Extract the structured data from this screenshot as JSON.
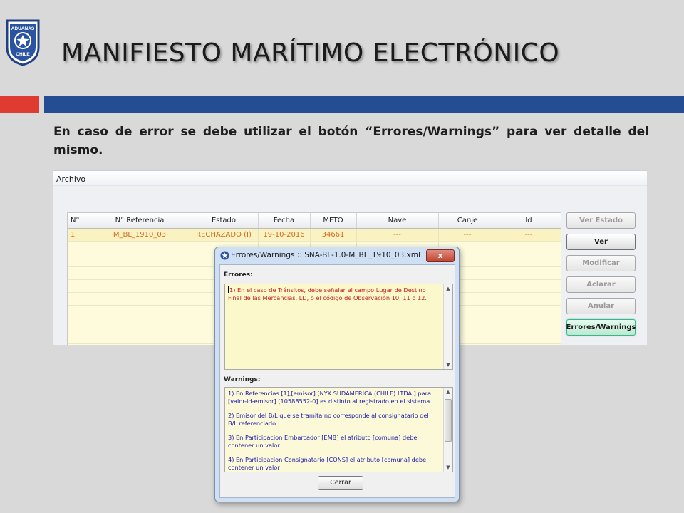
{
  "slide": {
    "title": "MANIFIESTO MARÍTIMO ELECTRÓNICO",
    "caption": "En caso de error se debe utilizar el botón “Errores/Warnings” para ver detalle del mismo.",
    "logo_text_top": "ADUANAS",
    "logo_text_bottom": "CHILE"
  },
  "app": {
    "menu": [
      "Archivo"
    ],
    "columns": [
      "N°",
      "N° Referencia",
      "Estado",
      "Fecha",
      "MFTO",
      "Nave",
      "Canje",
      "Id"
    ],
    "rows": [
      [
        "1",
        "M_BL_1910_03",
        "RECHAZADO (I)",
        "19-10-2016",
        "34661",
        "---",
        "---",
        "---"
      ]
    ],
    "buttons": {
      "ver_estado": "Ver Estado",
      "ver": "Ver",
      "modificar": "Modificar",
      "aclarar": "Aclarar",
      "anular": "Anular",
      "errores_warnings": "Errores/Warnings"
    }
  },
  "dialog": {
    "title": "Errores/Warnings :: SNA-BL-1.0-M_BL_1910_03.xml",
    "close_label": "x",
    "errores_label": "Errores:",
    "errores": [
      "1) En el caso de Tránsitos, debe señalar el campo Lugar de Destino Final de las Mercancias, LD,  o el código de Observación 10, 11 o 12."
    ],
    "warnings_label": "Warnings:",
    "warnings": [
      "1) En Referencias [1],[emisor] [NYK SUDAMERICA (CHILE) LTDA.] para [valor-id-emisor] [10588552-0] es distinto al registrado en el sistema",
      "2) Emisor del B/L que se tramita no corresponde al consignatario del B/L referenciado",
      "3) En Participacion Embarcador [EMB] el atributo [comuna] debe contener un valor",
      "4) En Participacion Consignatario [CONS] el atributo [comuna] debe contener un valor"
    ],
    "cerrar_label": "Cerrar"
  },
  "colors": {
    "band_red": "#e03b30",
    "band_blue": "#244d93",
    "error_text": "#c62020",
    "warning_text": "#1a1aa8",
    "row_text": "#d26a1f"
  }
}
